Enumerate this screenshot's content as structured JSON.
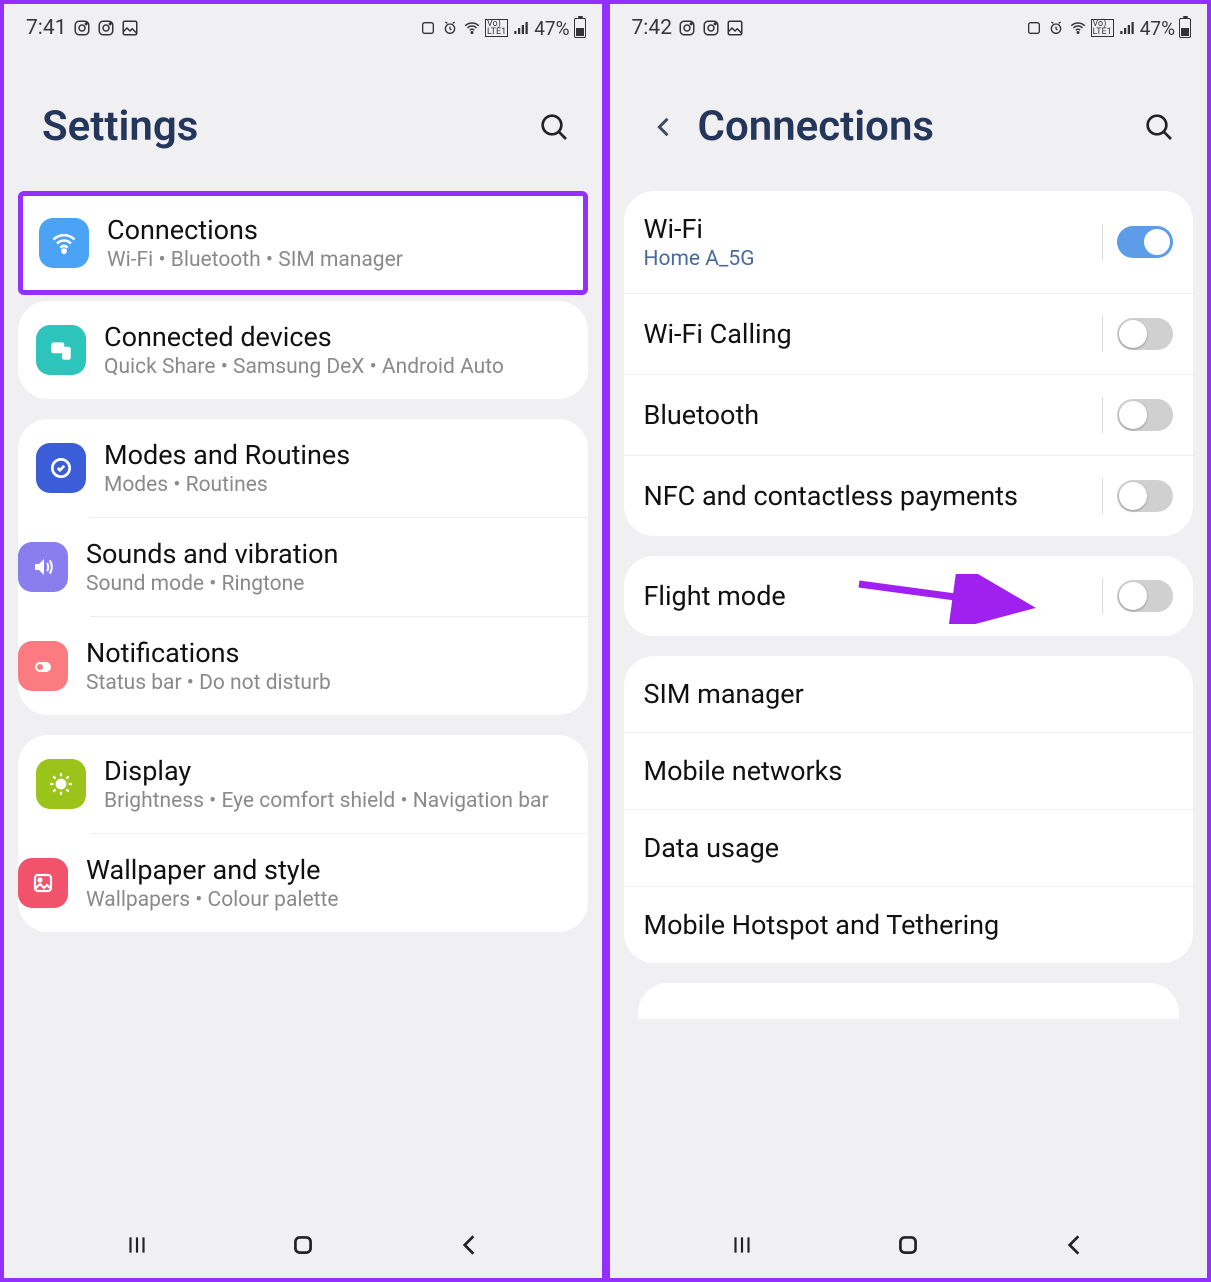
{
  "left": {
    "status": {
      "time": "7:41",
      "battery_pct": "47%"
    },
    "header": {
      "title": "Settings"
    },
    "groups": [
      {
        "highlight": true,
        "items": [
          {
            "title": "Connections",
            "sub": "Wi-Fi  •  Bluetooth  •  SIM manager",
            "icon": "wifi-icon",
            "color": "c-blue"
          }
        ]
      },
      {
        "items": [
          {
            "title": "Connected devices",
            "sub": "Quick Share  •  Samsung DeX  •  Android Auto",
            "icon": "devices-icon",
            "color": "c-teal"
          }
        ]
      },
      {
        "items": [
          {
            "title": "Modes and Routines",
            "sub": "Modes  •  Routines",
            "icon": "routines-icon",
            "color": "c-indigo"
          },
          {
            "title": "Sounds and vibration",
            "sub": "Sound mode  •  Ringtone",
            "icon": "sound-icon",
            "color": "c-purple"
          },
          {
            "title": "Notifications",
            "sub": "Status bar  •  Do not disturb",
            "icon": "notifications-icon",
            "color": "c-coral"
          }
        ]
      },
      {
        "items": [
          {
            "title": "Display",
            "sub": "Brightness  •  Eye comfort shield  •  Navigation bar",
            "icon": "display-icon",
            "color": "c-green"
          },
          {
            "title": "Wallpaper and style",
            "sub": "Wallpapers  •  Colour palette",
            "icon": "wallpaper-icon",
            "color": "c-pink"
          }
        ]
      }
    ]
  },
  "right": {
    "status": {
      "time": "7:42",
      "battery_pct": "47%"
    },
    "header": {
      "title": "Connections"
    },
    "groups": [
      {
        "items": [
          {
            "title": "Wi-Fi",
            "sub": "Home A_5G",
            "toggle": true,
            "on": true
          },
          {
            "title": "Wi-Fi Calling",
            "toggle": true,
            "on": false
          },
          {
            "title": "Bluetooth",
            "toggle": true,
            "on": false
          },
          {
            "title": "NFC and contactless payments",
            "toggle": true,
            "on": false
          }
        ]
      },
      {
        "items": [
          {
            "title": "Flight mode",
            "toggle": true,
            "on": false,
            "arrow": true
          }
        ]
      },
      {
        "items": [
          {
            "title": "SIM manager"
          },
          {
            "title": "Mobile networks"
          },
          {
            "title": "Data usage"
          },
          {
            "title": "Mobile Hotspot and Tethering"
          }
        ]
      }
    ]
  }
}
